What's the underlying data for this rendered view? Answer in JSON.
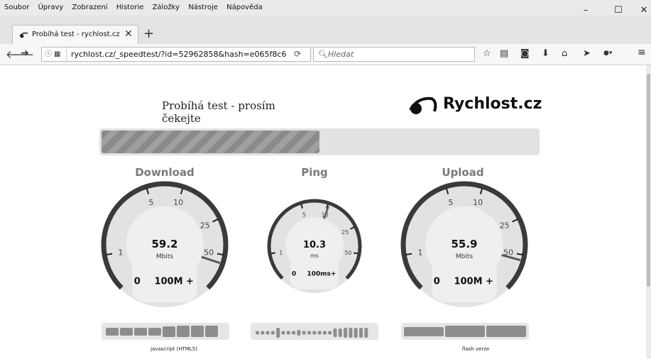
{
  "browser": {
    "menu": [
      "Soubor",
      "Úpravy",
      "Zobrazení",
      "Historie",
      "Záložky",
      "Nástroje",
      "Nápověda"
    ],
    "window_controls": {
      "minimize": "–",
      "maximize": "☐",
      "close": "✕"
    },
    "tab": {
      "title": "Probíhá test - rychlost.cz",
      "close": "✕"
    },
    "new_tab": "+",
    "url": "rychlost.cz/_speedtest/?id=52962858&hash=e065f8c6",
    "search_placeholder": "Hledat",
    "toolbar_icons": [
      "star-icon",
      "reading-list-icon",
      "pocket-icon",
      "download-icon",
      "home-icon",
      "send-icon",
      "adblock-icon",
      "menu-icon"
    ]
  },
  "page": {
    "status": "Probíhá test - prosím čekejte",
    "logo": "Rychlost.cz",
    "progress": 0.5
  },
  "gauges": {
    "download": {
      "title": "Download",
      "value": "59.2",
      "unit": "Mbits",
      "ticks": [
        "1",
        "5",
        "10",
        "25",
        "50"
      ],
      "min": "0",
      "max": "100M +",
      "reading": 59.2
    },
    "ping": {
      "title": "Ping",
      "value": "10.3",
      "unit": "ms",
      "ticks": [
        "1",
        "5",
        "10",
        "25",
        "50"
      ],
      "min": "0",
      "max": "100ms+",
      "reading": 10.3
    },
    "upload": {
      "title": "Upload",
      "value": "55.9",
      "unit": "Mbits",
      "ticks": [
        "1",
        "5",
        "10",
        "25",
        "50"
      ],
      "min": "0",
      "max": "100M +",
      "reading": 55.9
    }
  },
  "captions": {
    "left": "javascript (HTML5)",
    "right": "flash verze"
  },
  "colors": {
    "needle": "#555555",
    "gauge_face": "#e2e2e2",
    "gauge_ring": "#3a3a3a"
  }
}
